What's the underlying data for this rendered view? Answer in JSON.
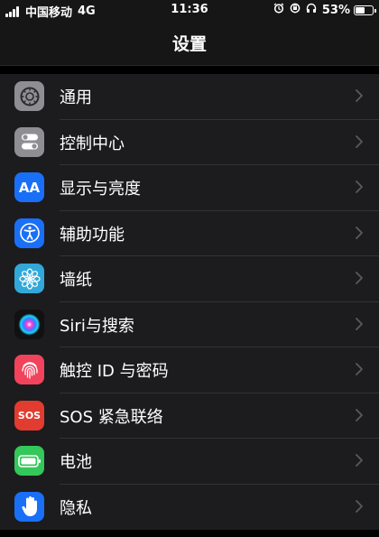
{
  "status_bar": {
    "carrier": "中国移动",
    "network": "4G",
    "time": "11:36",
    "battery_percent_text": "53%",
    "battery_level": 0.53
  },
  "nav": {
    "title": "设置"
  },
  "settings": [
    {
      "label": "通用",
      "icon": "gear-icon",
      "color": "#8e8e93"
    },
    {
      "label": "控制中心",
      "icon": "toggles-icon",
      "color": "#8e8e93"
    },
    {
      "label": "显示与亮度",
      "icon": "text-size-icon",
      "color": "#1a6ff7",
      "icon_text": "AA"
    },
    {
      "label": "辅助功能",
      "icon": "accessibility-icon",
      "color": "#1a6ff7"
    },
    {
      "label": "墙纸",
      "icon": "flower-icon",
      "color": "#32a8d9"
    },
    {
      "label": "Siri与搜索",
      "icon": "siri-icon",
      "color": "#111111"
    },
    {
      "label": "触控 ID 与密码",
      "icon": "fingerprint-icon",
      "color": "#f2435c"
    },
    {
      "label": "SOS 紧急联络",
      "icon": "sos-icon",
      "color": "#e23b2f",
      "icon_text": "SOS"
    },
    {
      "label": "电池",
      "icon": "battery-icon",
      "color": "#34c759"
    },
    {
      "label": "隐私",
      "icon": "hand-icon",
      "color": "#1a6ff7"
    }
  ]
}
